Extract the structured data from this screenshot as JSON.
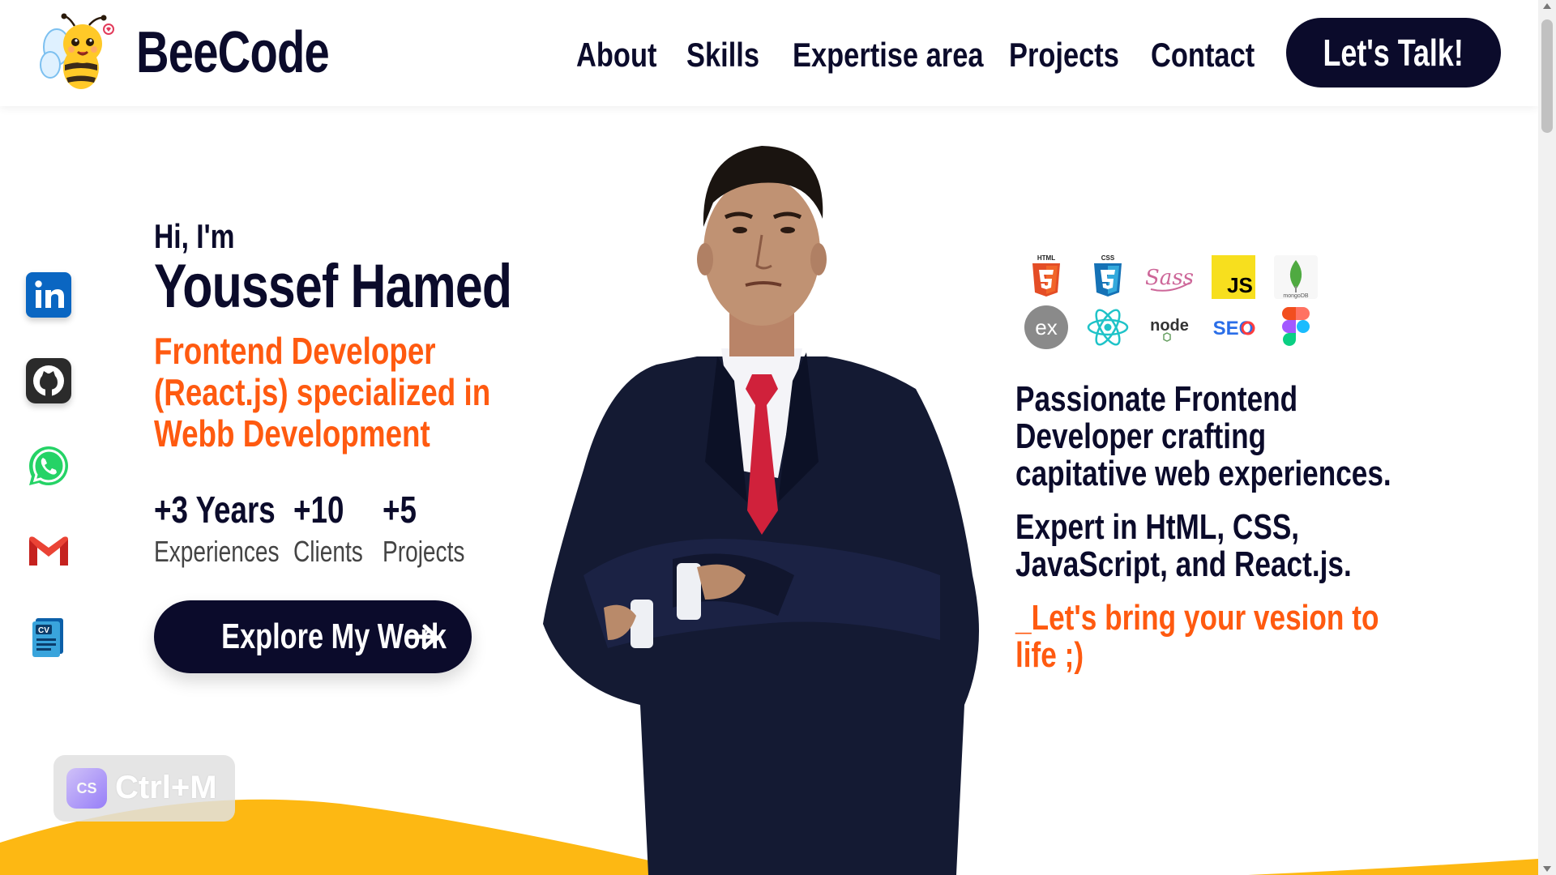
{
  "header": {
    "brand": "BeeCode",
    "nav": [
      "About",
      "Skills",
      "Expertise area",
      "Projects",
      "Contact"
    ],
    "cta": "Let's Talk!"
  },
  "social": {
    "icons": [
      "linkedin-icon",
      "github-icon",
      "whatsapp-icon",
      "gmail-icon",
      "cv-icon"
    ],
    "cv_label": "CV"
  },
  "hero": {
    "greeting": "Hi, I'm",
    "name": "Youssef Hamed",
    "role_lines": [
      "Frontend Developer",
      "(React.js) specialized in",
      "Webb Development"
    ],
    "stats": [
      {
        "value": "+3 Years",
        "label": "Experiences"
      },
      {
        "value": "+10",
        "label": "Clients"
      },
      {
        "value": "+5",
        "label": "Projects"
      }
    ],
    "explore_button": "Explore My Work"
  },
  "tech_stack": {
    "icons": [
      "html5-icon",
      "css3-icon",
      "sass-icon",
      "javascript-icon",
      "mongodb-icon",
      "express-icon",
      "react-icon",
      "nodejs-icon",
      "seo-icon",
      "figma-icon"
    ],
    "labels": {
      "html": "HTML",
      "css": "CSS",
      "sass": "Sass",
      "js": "JS",
      "mongo": "mongoDB",
      "express": "ex",
      "node": "node",
      "seo": "SEO"
    }
  },
  "about": {
    "passion_lines": [
      "Passionate Frontend",
      "Developer crafting",
      "capitative web experiences."
    ],
    "expert_lines": [
      "Expert in HtML, CSS,",
      "JavaScript, and React.js."
    ],
    "tagline_lines": [
      "_Let's bring your vesion to",
      "life ;)"
    ]
  },
  "extension_badge": {
    "icon_label": "CS",
    "shortcut": "Ctrl+M"
  },
  "colors": {
    "navy": "#0b0b2b",
    "accent_orange": "#ff5a10",
    "wave_yellow": "#fdb813"
  }
}
